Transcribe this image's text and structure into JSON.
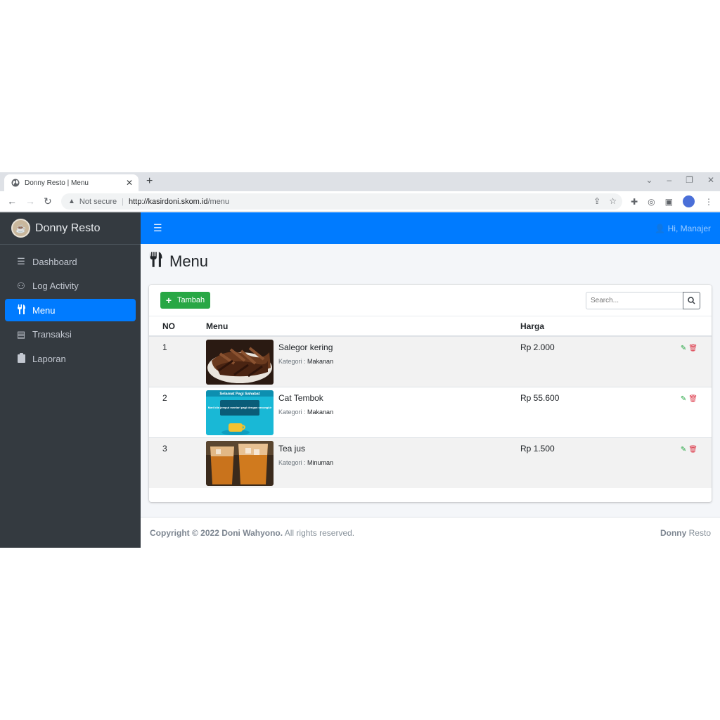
{
  "browser": {
    "tab_title": "Donny Resto | Menu",
    "security": "Not secure",
    "url_host": "http://kasirdoni.skom.id",
    "url_path": "/menu"
  },
  "sidebar": {
    "brand": "Donny Resto",
    "items": [
      {
        "label": "Dashboard",
        "icon": "list-icon",
        "active": false
      },
      {
        "label": "Log Activity",
        "icon": "user-log-icon",
        "active": false
      },
      {
        "label": "Menu",
        "icon": "utensils-icon",
        "active": true
      },
      {
        "label": "Transaksi",
        "icon": "cash-register-icon",
        "active": false
      },
      {
        "label": "Laporan",
        "icon": "clipboard-icon",
        "active": false
      }
    ]
  },
  "topbar": {
    "user_label": "Hi, Manajer"
  },
  "page": {
    "title": "Menu"
  },
  "toolbar": {
    "add_label": "Tambah",
    "search_placeholder": "Search..."
  },
  "table": {
    "headers": [
      "NO",
      "Menu",
      "Harga",
      ""
    ],
    "category_label": "Kategori :",
    "rows": [
      {
        "no": "1",
        "name": "Salegor kering",
        "category": "Makanan",
        "price": "Rp 2.000"
      },
      {
        "no": "2",
        "name": "Cat Tembok",
        "category": "Makanan",
        "price": "Rp 55.600"
      },
      {
        "no": "3",
        "name": "Tea jus",
        "category": "Minuman",
        "price": "Rp 1.500"
      }
    ],
    "image_texts": {
      "row2_header": "Selamat Pagi Sahabat",
      "row2_body": "Mari kita jemput mentari pagi dengan secangkir"
    }
  },
  "footer": {
    "copyright": "Copyright © 2022 Doni Wahyono.",
    "rights": "All rights reserved.",
    "brand_bold": "Donny",
    "brand_rest": "Resto"
  },
  "colors": {
    "primary": "#007bff",
    "sidebar": "#343a40",
    "success": "#28a745",
    "danger": "#dc3545"
  }
}
